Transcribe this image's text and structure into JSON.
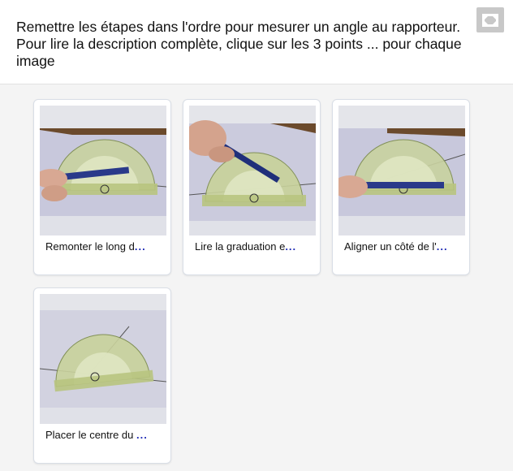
{
  "instruction": {
    "line1": "Remettre les étapes dans l'ordre pour mesurer un angle au rapporteur.",
    "line2": "Pour lire la description complète, clique sur les 3 points ... pour chaque",
    "line3": "image"
  },
  "cards": [
    {
      "caption": "Remonter le long d",
      "more": "...",
      "image_icon": "protractor-photo-icon"
    },
    {
      "caption": "Lire la graduation e",
      "more": "...",
      "image_icon": "protractor-photo-icon"
    },
    {
      "caption": "Aligner un côté de l'",
      "more": "...",
      "image_icon": "protractor-photo-icon"
    },
    {
      "caption": "Placer le centre du ",
      "more": "...",
      "image_icon": "protractor-photo-icon"
    }
  ],
  "colors": {
    "accent": "#1f2bb5",
    "button_bg": "#c8c8c8",
    "content_bg": "#f4f4f4",
    "card_border": "#d9dee6"
  },
  "icons": {
    "fullscreen": "fullscreen-icon"
  }
}
